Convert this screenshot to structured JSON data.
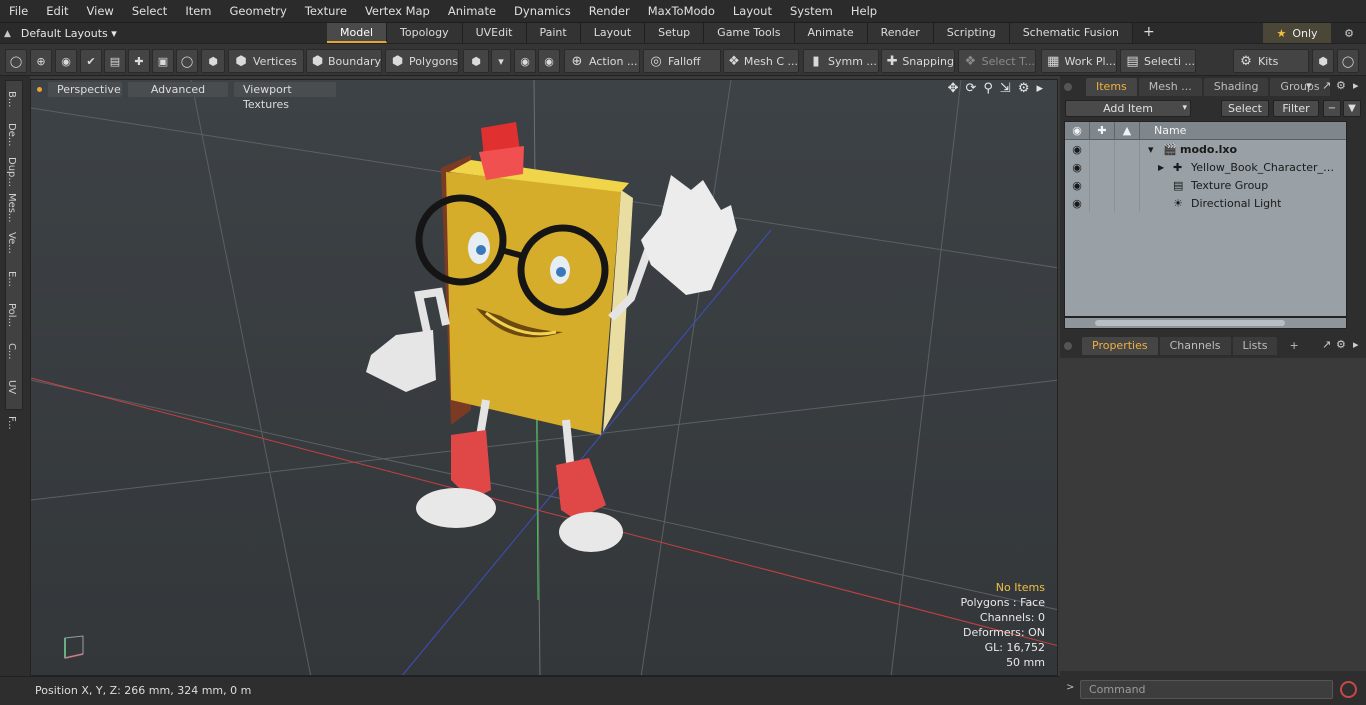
{
  "menubar": [
    "File",
    "Edit",
    "View",
    "Select",
    "Item",
    "Geometry",
    "Texture",
    "Vertex Map",
    "Animate",
    "Dynamics",
    "Render",
    "MaxToModo",
    "Layout",
    "System",
    "Help"
  ],
  "layouts": {
    "label": "Default Layouts"
  },
  "mode_tabs": [
    {
      "label": "Model",
      "active": true
    },
    {
      "label": "Topology"
    },
    {
      "label": "UVEdit"
    },
    {
      "label": "Paint"
    },
    {
      "label": "Layout"
    },
    {
      "label": "Setup"
    },
    {
      "label": "Game Tools"
    },
    {
      "label": "Animate"
    },
    {
      "label": "Render"
    },
    {
      "label": "Scripting"
    },
    {
      "label": "Schematic Fusion"
    }
  ],
  "only_label": "Only",
  "toolbar": {
    "vertices": "Vertices",
    "boundary": "Boundary",
    "polygons": "Polygons",
    "action": "Action ...",
    "falloff": "Falloff",
    "mesh": "Mesh C ...",
    "symm": "Symm ...",
    "snapping": "Snapping",
    "select_t": "Select T...",
    "work_plane": "Work Pl...",
    "selecti": "Selecti ...",
    "kits": "Kits"
  },
  "viewport": {
    "perspective": "Perspective",
    "advanced": "Advanced",
    "textures": "Viewport Textures",
    "stats": [
      "No Items",
      "Polygons : Face",
      "Channels: 0",
      "Deformers: ON",
      "GL: 16,752",
      "50 mm"
    ]
  },
  "side_tabs": [
    "B...",
    "De...",
    "Dup...",
    "Mes...",
    "Ve...",
    "E...",
    "Pol...",
    "C...",
    "UV",
    "F..."
  ],
  "status": "Position X, Y, Z:  266 mm, 324 mm, 0 m",
  "items_panel": {
    "tabs": [
      "Items",
      "Mesh ...",
      "Shading",
      "Groups"
    ],
    "add_item": "Add Item",
    "select": "Select",
    "filter": "Filter",
    "name_header": "Name",
    "tree": [
      {
        "label": "modo.lxo"
      },
      {
        "label": "Yellow_Book_Character_Wavi..."
      },
      {
        "label": "Texture Group"
      },
      {
        "label": "Directional Light"
      }
    ]
  },
  "props_panel": {
    "tabs": [
      "Properties",
      "Channels",
      "Lists"
    ]
  },
  "command": {
    "placeholder": "Command"
  },
  "colors": {
    "accent": "#e8a530",
    "book": "#e8c030",
    "shoe": "#e04848"
  }
}
